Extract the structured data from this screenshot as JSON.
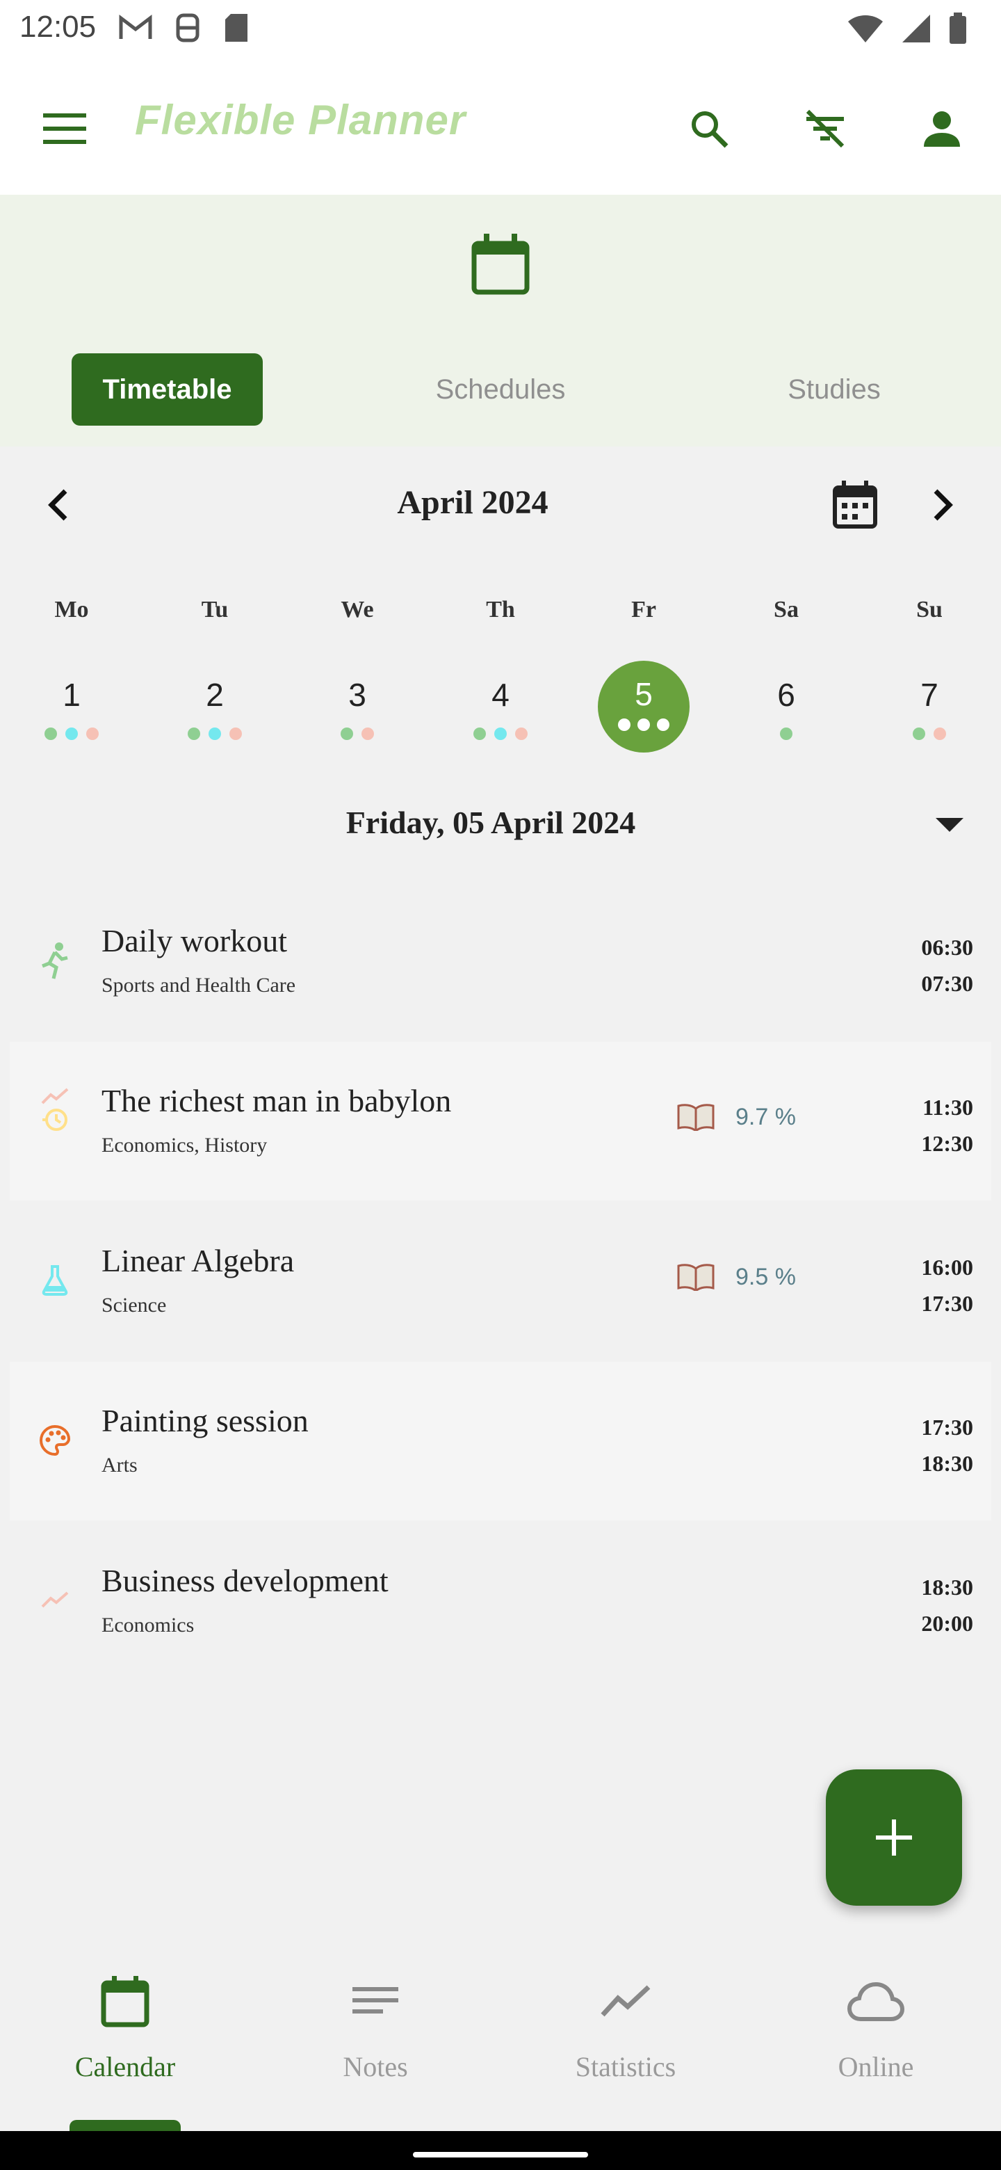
{
  "status_bar": {
    "time": "12:05"
  },
  "app_bar": {
    "title": "Flexible Planner"
  },
  "tabs": [
    {
      "label": "Timetable",
      "active": true
    },
    {
      "label": "Schedules",
      "active": false
    },
    {
      "label": "Studies",
      "active": false
    }
  ],
  "calendar": {
    "month_title": "April 2024",
    "weekdays": [
      "Mo",
      "Tu",
      "We",
      "Th",
      "Fr",
      "Sa",
      "Su"
    ],
    "days": [
      "1",
      "2",
      "3",
      "4",
      "5",
      "6",
      "7"
    ],
    "selected_day": "5",
    "selected_date_label": "Friday, 05 April 2024"
  },
  "colors": {
    "primary": "#2f6b1f",
    "selected": "#69a23d",
    "sports": "#8fcf92",
    "science": "#74e8ee",
    "economics": "#f6c1b5",
    "arts": "#e86e2a",
    "history": "#ffe08a"
  },
  "events": [
    {
      "title": "Daily workout",
      "subtitle": "Sports and Health Care",
      "start": "06:30",
      "end": "07:30",
      "icon": "run-icon",
      "progress": ""
    },
    {
      "title": "The richest man in babylon",
      "subtitle": "Economics, History",
      "start": "11:30",
      "end": "12:30",
      "icon": "trend-icon",
      "progress": "9.7 %"
    },
    {
      "title": "Linear Algebra",
      "subtitle": "Science",
      "start": "16:00",
      "end": "17:30",
      "icon": "flask-icon",
      "progress": "9.5 %"
    },
    {
      "title": "Painting session",
      "subtitle": "Arts",
      "start": "17:30",
      "end": "18:30",
      "icon": "palette-icon",
      "progress": ""
    },
    {
      "title": "Business development",
      "subtitle": "Economics",
      "start": "18:30",
      "end": "20:00",
      "icon": "trend-icon",
      "progress": ""
    }
  ],
  "bottom_nav": [
    {
      "label": "Calendar",
      "active": true
    },
    {
      "label": "Notes",
      "active": false
    },
    {
      "label": "Statistics",
      "active": false
    },
    {
      "label": "Online",
      "active": false
    }
  ]
}
